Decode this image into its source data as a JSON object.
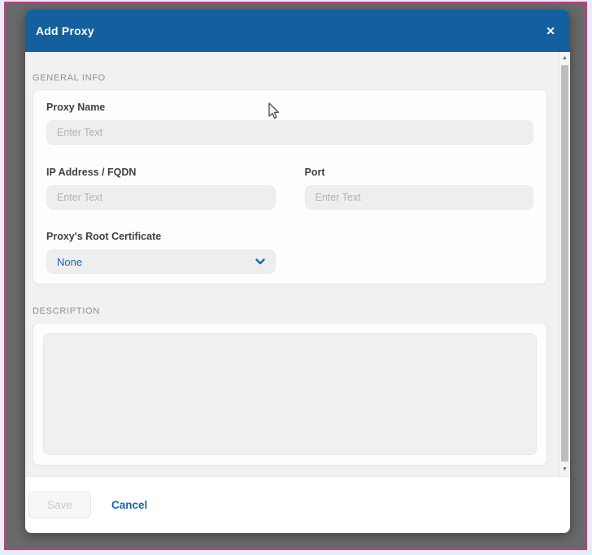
{
  "modal": {
    "title": "Add Proxy",
    "sections": {
      "general_info_heading": "GENERAL INFO",
      "description_heading": "DESCRIPTION"
    },
    "fields": {
      "proxy_name": {
        "label": "Proxy Name",
        "placeholder": "Enter Text",
        "value": ""
      },
      "ip_address": {
        "label": "IP Address / FQDN",
        "placeholder": "Enter Text",
        "value": ""
      },
      "port": {
        "label": "Port",
        "placeholder": "Enter Text",
        "value": ""
      },
      "root_certificate": {
        "label": "Proxy's Root Certificate",
        "selected_option": "None"
      }
    },
    "description": {
      "value": ""
    },
    "footer": {
      "save_label": "Save",
      "cancel_label": "Cancel"
    }
  },
  "icons": {
    "close": "✕",
    "scroll_up": "▲",
    "scroll_down": "▼"
  },
  "colors": {
    "header_blue": "#14609f",
    "accent_blue": "#1965af",
    "backdrop_gray": "#696969",
    "capture_border_pink": "#c0407b",
    "body_gray": "#f1f1f2"
  }
}
